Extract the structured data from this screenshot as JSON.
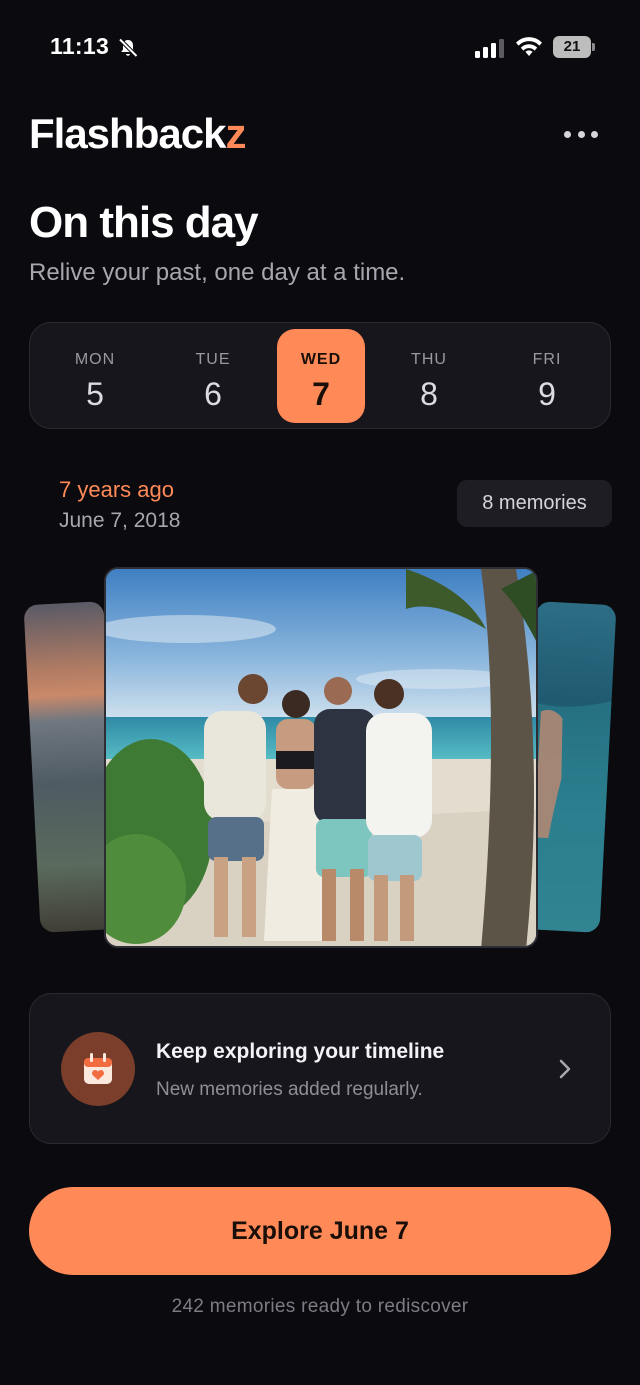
{
  "status_bar": {
    "time": "11:13",
    "battery": "21"
  },
  "header": {
    "brand_main": "Flashback",
    "brand_accent": "z"
  },
  "hero": {
    "title": "On this day",
    "subtitle": "Relive your past, one day at a time."
  },
  "days": [
    {
      "dow": "MON",
      "num": "5"
    },
    {
      "dow": "TUE",
      "num": "6"
    },
    {
      "dow": "WED",
      "num": "7",
      "active": true
    },
    {
      "dow": "THU",
      "num": "8"
    },
    {
      "dow": "FRI",
      "num": "9"
    }
  ],
  "memory": {
    "years_ago": "7 years ago",
    "date": "June 7, 2018",
    "count": "8 memories"
  },
  "explore_card": {
    "title": "Keep exploring your timeline",
    "subtitle": "New memories added regularly."
  },
  "cta": {
    "label": "Explore June 7"
  },
  "footnote": "242 memories ready to rediscover",
  "colors": {
    "accent": "#ff8a57",
    "background": "#0b0a0f",
    "card": "#17161c"
  }
}
